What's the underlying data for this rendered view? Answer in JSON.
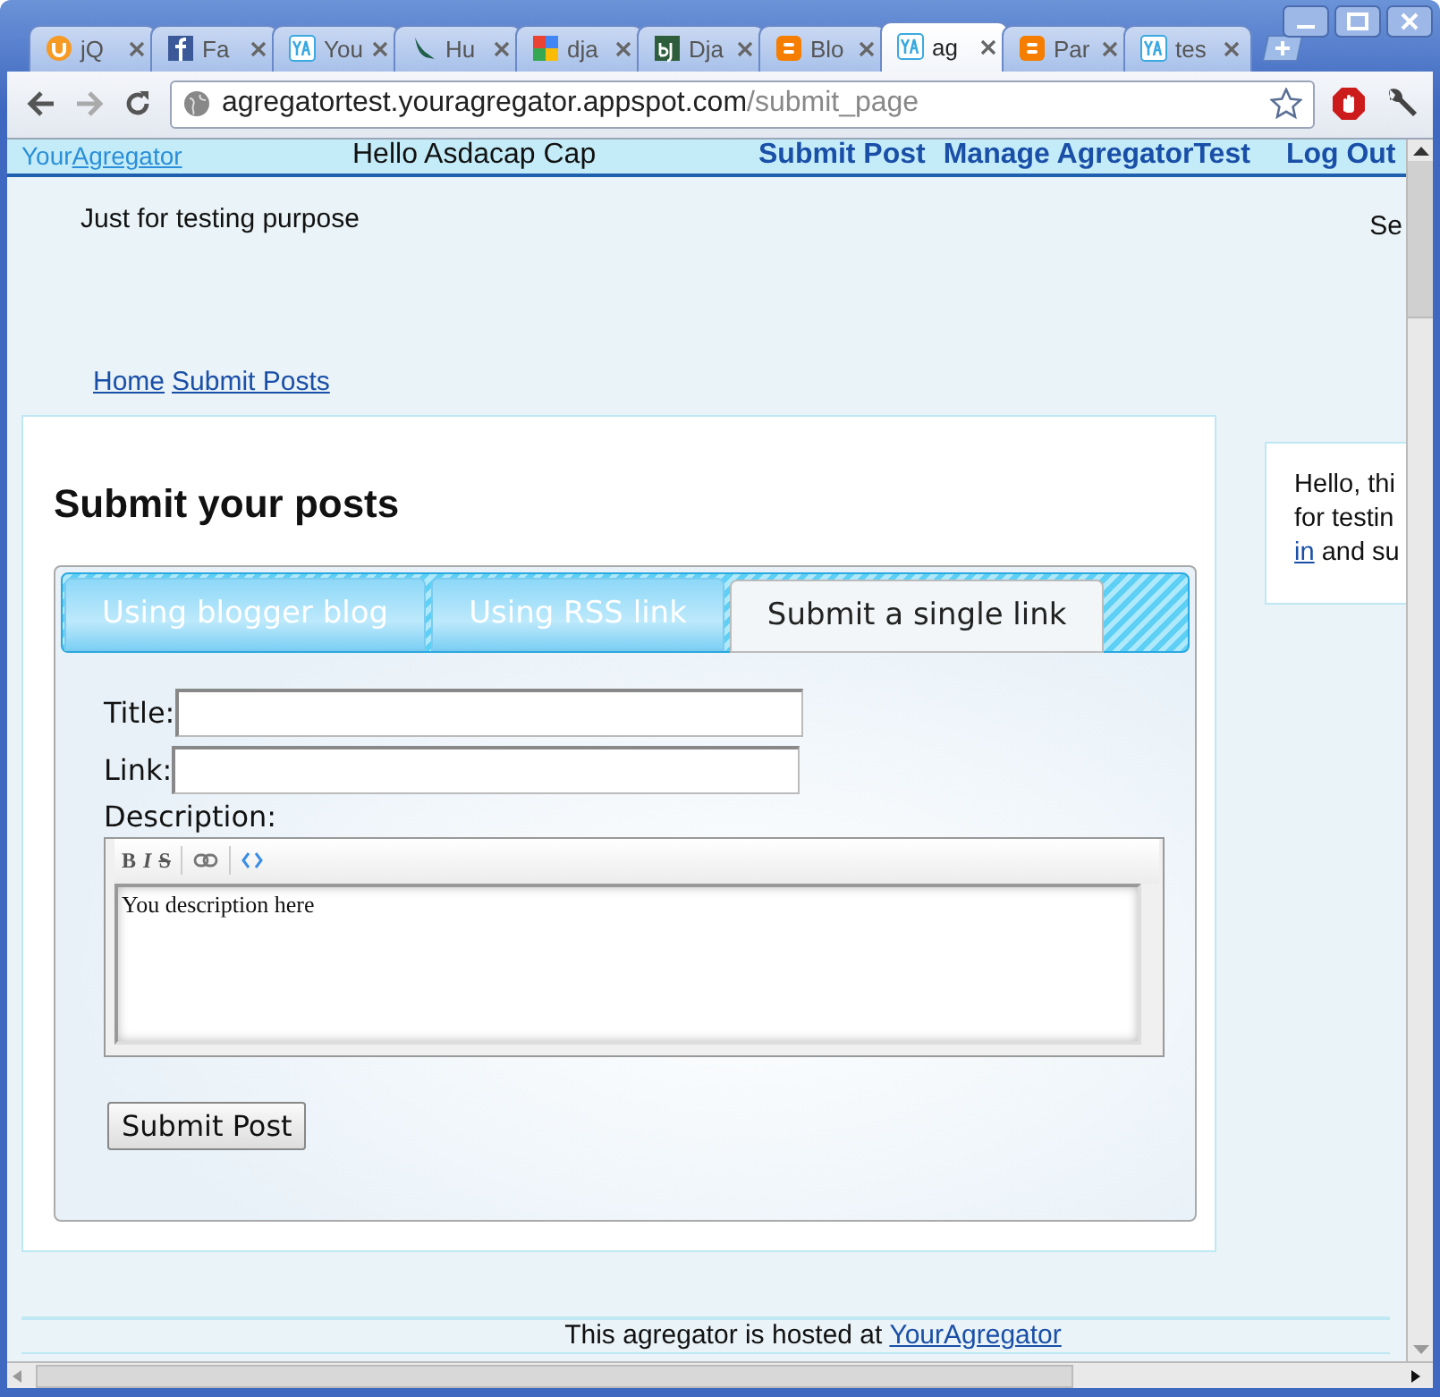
{
  "browser": {
    "tabs": [
      {
        "title": "jQ",
        "kind": "smiley",
        "selected": false
      },
      {
        "title": "Fa",
        "kind": "facebook",
        "selected": false
      },
      {
        "title": "You",
        "kind": "ya",
        "selected": false
      },
      {
        "title": "Hu",
        "kind": "bird",
        "selected": false
      },
      {
        "title": "dja",
        "kind": "google",
        "selected": false
      },
      {
        "title": "Dja",
        "kind": "dj",
        "selected": false
      },
      {
        "title": "Blo",
        "kind": "blogger",
        "selected": false
      },
      {
        "title": "ag",
        "kind": "ya",
        "selected": true
      },
      {
        "title": "Par",
        "kind": "blogger",
        "selected": false
      },
      {
        "title": "tes",
        "kind": "ya",
        "selected": false
      }
    ],
    "address": {
      "host": "agregatortest.youragregator.appspot.com",
      "path": "/submit_page"
    }
  },
  "page": {
    "topbar": {
      "brand_plain": "Your",
      "brand_link": "Agregator",
      "greeting": "Hello Asdacap Cap",
      "links": [
        "Submit Post",
        "Manage AgregatorTest",
        "Log Out"
      ]
    },
    "tagline": "Just for testing purpose",
    "side_label": "Se",
    "breadcrumbs": [
      "Home",
      "Submit Posts"
    ],
    "heading": "Submit your posts",
    "tabs": [
      {
        "label": "Using blogger blog",
        "selected": false
      },
      {
        "label": "Using RSS link",
        "selected": false
      },
      {
        "label": "Submit a single link",
        "selected": true
      }
    ],
    "form": {
      "title_label": "Title:",
      "link_label": "Link:",
      "description_label": "Description:",
      "editor_buttons": [
        "B",
        "I",
        "S"
      ],
      "editor_text": "You description here",
      "submit": "Submit Post"
    },
    "sidebar": {
      "line_1": "Hello, thi",
      "line_2": "for testin",
      "link": "in",
      "line_3": "and su"
    },
    "footer": {
      "text": "This agregator is hosted at",
      "link": "YourAgregator"
    }
  }
}
